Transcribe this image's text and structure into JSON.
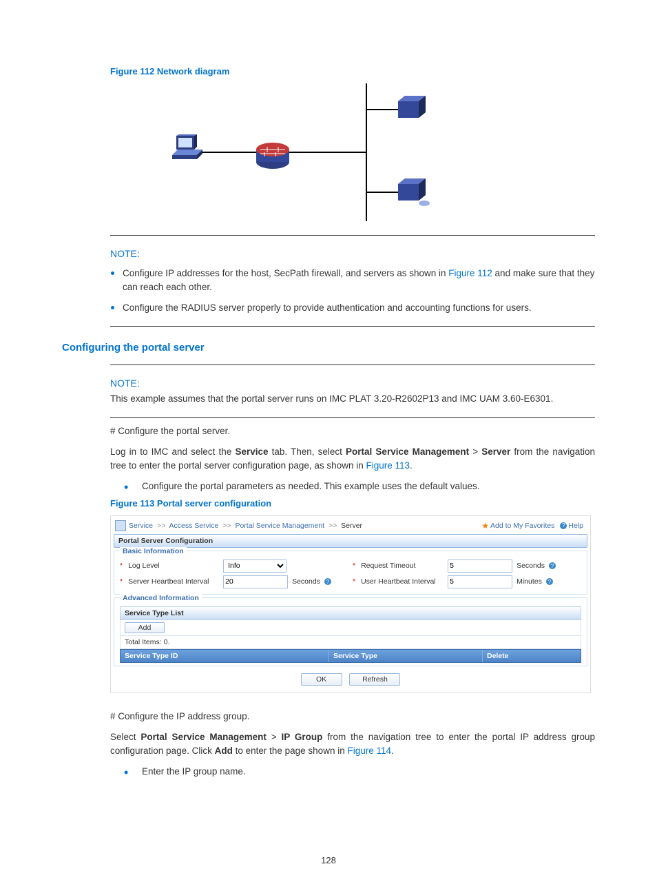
{
  "figure112": {
    "caption": "Figure 112 Network diagram"
  },
  "note1": {
    "label": "NOTE:",
    "bullet1_prefix": "Configure IP addresses for the host, SecPath firewall, and servers as shown in ",
    "bullet1_link": "Figure 112",
    "bullet1_suffix": " and make sure that they can reach each other.",
    "bullet2": "Configure the RADIUS server properly to provide authentication and accounting functions for users."
  },
  "section": {
    "title": "Configuring the portal server"
  },
  "note2": {
    "label": "NOTE:",
    "text": "This example assumes that the portal server runs on IMC PLAT 3.20-R2602P13 and IMC UAM 3.60-E6301."
  },
  "p1": "# Configure the portal server.",
  "p2": {
    "t1": "Log in to IMC and select the ",
    "b1": "Service",
    "t2": " tab. Then, select ",
    "b2": "Portal Service Management",
    "t3": " > ",
    "b3": "Server",
    "t4": " from the navigation tree to enter the portal server configuration page, as shown in ",
    "link": "Figure 113",
    "t5": "."
  },
  "bullet_p2": "Configure the portal parameters as needed. This example uses the default values.",
  "figure113": {
    "caption": "Figure 113 Portal server configuration"
  },
  "imc": {
    "crumbs": {
      "c1": "Service",
      "c2": "Access Service",
      "c3": "Portal Service Management",
      "c4": "Server"
    },
    "fav": "Add to My Favorites",
    "help": "Help",
    "title": "Portal Server Configuration",
    "basic_legend": "Basic Information",
    "loglevel_label": "Log Level",
    "loglevel_value": "Info",
    "server_hb_label": "Server Heartbeat Interval",
    "server_hb_value": "20",
    "seconds": "Seconds",
    "request_timeout_label": "Request Timeout",
    "request_timeout_value": "5",
    "user_hb_label": "User Heartbeat Interval",
    "user_hb_value": "5",
    "minutes": "Minutes",
    "adv_legend": "Advanced Information",
    "svc_list": "Service Type List",
    "add": "Add",
    "totals": "Total Items: 0.",
    "col1": "Service Type ID",
    "col2": "Service Type",
    "col3": "Delete",
    "ok": "OK",
    "refresh": "Refresh"
  },
  "p3": "# Configure the IP address group.",
  "p4": {
    "t1": "Select ",
    "b1": "Portal Service Management",
    "t2": " > ",
    "b2": "IP Group",
    "t3": " from the navigation tree to enter the portal IP address group configuration page. Click ",
    "b3": "Add",
    "t4": " to enter the page shown in ",
    "link": "Figure 114",
    "t5": "."
  },
  "bullet_p4": "Enter the IP group name.",
  "page_number": "128"
}
